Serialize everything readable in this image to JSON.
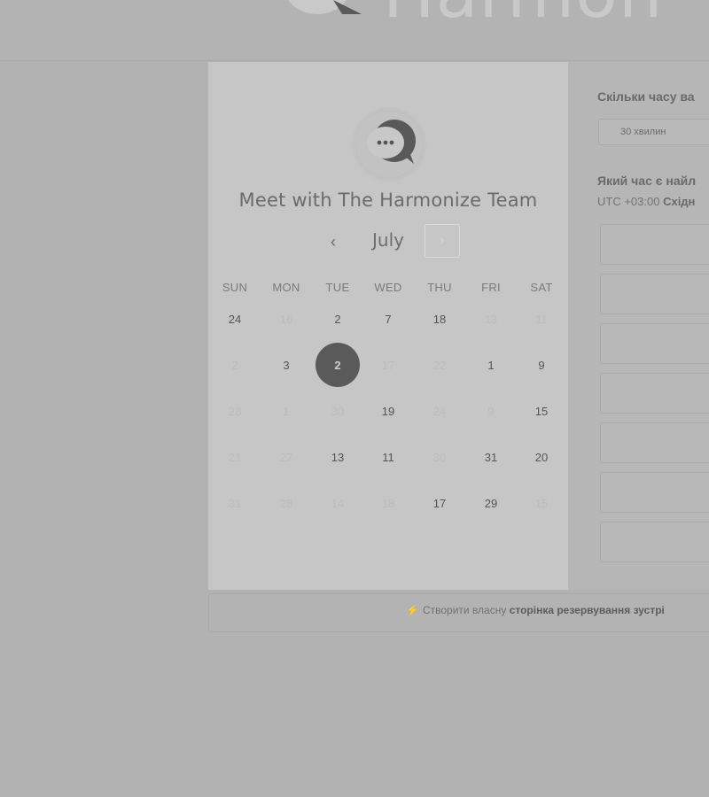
{
  "brand": {
    "text": "Harmon"
  },
  "scheduler": {
    "title": "Meet with The Harmonize Team",
    "month": "July",
    "prev_label": "‹",
    "next_label": "›",
    "weekdays": [
      "SUN",
      "MON",
      "TUE",
      "WED",
      "THU",
      "FRI",
      "SAT"
    ],
    "weeks": [
      [
        {
          "d": "24",
          "on": true
        },
        {
          "d": "16",
          "on": false
        },
        {
          "d": "2",
          "on": true
        },
        {
          "d": "7",
          "on": true
        },
        {
          "d": "18",
          "on": true
        },
        {
          "d": "13",
          "on": false
        },
        {
          "d": "11",
          "on": false
        }
      ],
      [
        {
          "d": "2",
          "on": false
        },
        {
          "d": "3",
          "on": true
        },
        {
          "d": "2",
          "on": true,
          "sel": true
        },
        {
          "d": "17",
          "on": false
        },
        {
          "d": "22",
          "on": false
        },
        {
          "d": "1",
          "on": true
        },
        {
          "d": "9",
          "on": true
        }
      ],
      [
        {
          "d": "28",
          "on": false
        },
        {
          "d": "1",
          "on": false
        },
        {
          "d": "30",
          "on": false
        },
        {
          "d": "19",
          "on": true
        },
        {
          "d": "24",
          "on": false
        },
        {
          "d": "9",
          "on": false
        },
        {
          "d": "15",
          "on": true
        }
      ],
      [
        {
          "d": "21",
          "on": false
        },
        {
          "d": "27",
          "on": false
        },
        {
          "d": "13",
          "on": true
        },
        {
          "d": "11",
          "on": true
        },
        {
          "d": "30",
          "on": false
        },
        {
          "d": "31",
          "on": true
        },
        {
          "d": "20",
          "on": true
        }
      ],
      [
        {
          "d": "31",
          "on": false
        },
        {
          "d": "28",
          "on": false
        },
        {
          "d": "14",
          "on": false
        },
        {
          "d": "18",
          "on": false
        },
        {
          "d": "17",
          "on": true
        },
        {
          "d": "29",
          "on": true
        },
        {
          "d": "15",
          "on": false
        }
      ]
    ]
  },
  "duration": {
    "question": "Скільки часу ва",
    "selected": "30 хвилин"
  },
  "time": {
    "question": "Який час є найл",
    "tz_prefix": "UTC +03:00",
    "tz_name": "Східн",
    "slots": 7
  },
  "footer": {
    "icon": "wand-icon",
    "text_plain": "Створити власну",
    "text_bold": "сторінка резервування зустрі"
  }
}
